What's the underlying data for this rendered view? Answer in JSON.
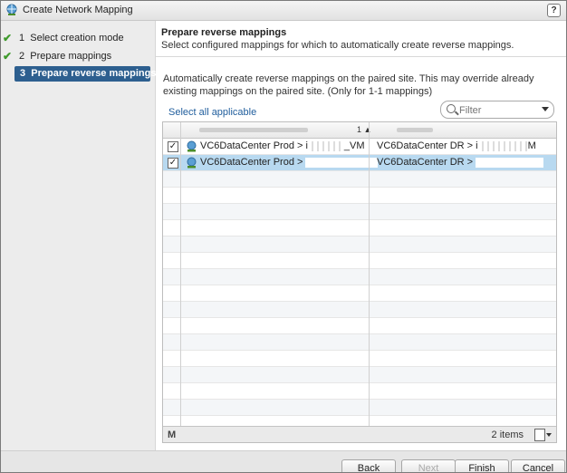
{
  "window": {
    "title": "Create Network Mapping",
    "help_label": "?"
  },
  "steps": [
    {
      "number": "1",
      "label": "Select creation mode",
      "done": true
    },
    {
      "number": "2",
      "label": "Prepare mappings",
      "done": true
    },
    {
      "number": "3",
      "label": "Prepare reverse mappings",
      "done": false,
      "active": true
    }
  ],
  "main": {
    "title": "Prepare reverse mappings",
    "subtitle": "Select configured mappings for which to automatically create reverse mappings.",
    "description": "Automatically create reverse mappings on the paired site. This may override already existing mappings on the paired site. (Only for 1-1 mappings)",
    "select_all": "Select all applicable",
    "filter_placeholder": "Filter"
  },
  "grid": {
    "sort_indicator": "1 ▲",
    "rows": [
      {
        "checked": true,
        "source": "VC6DataCenter Prod > i",
        "source_tail": "_VM",
        "target": "VC6DataCenter DR > i",
        "target_tail": "M",
        "selected": false
      },
      {
        "checked": true,
        "source": "VC6DataCenter Prod > ",
        "source_tail": "",
        "target": "VC6DataCenter DR > ",
        "target_tail": "",
        "selected": true
      }
    ],
    "item_count": "2 items"
  },
  "footer": {
    "back": "Back",
    "next": "Next",
    "finish": "Finish",
    "cancel": "Cancel"
  },
  "colors": {
    "accent": "#2d5f8f",
    "selection": "#b8d9f0",
    "check": "#3e9a2b",
    "link": "#1f5d9c"
  }
}
